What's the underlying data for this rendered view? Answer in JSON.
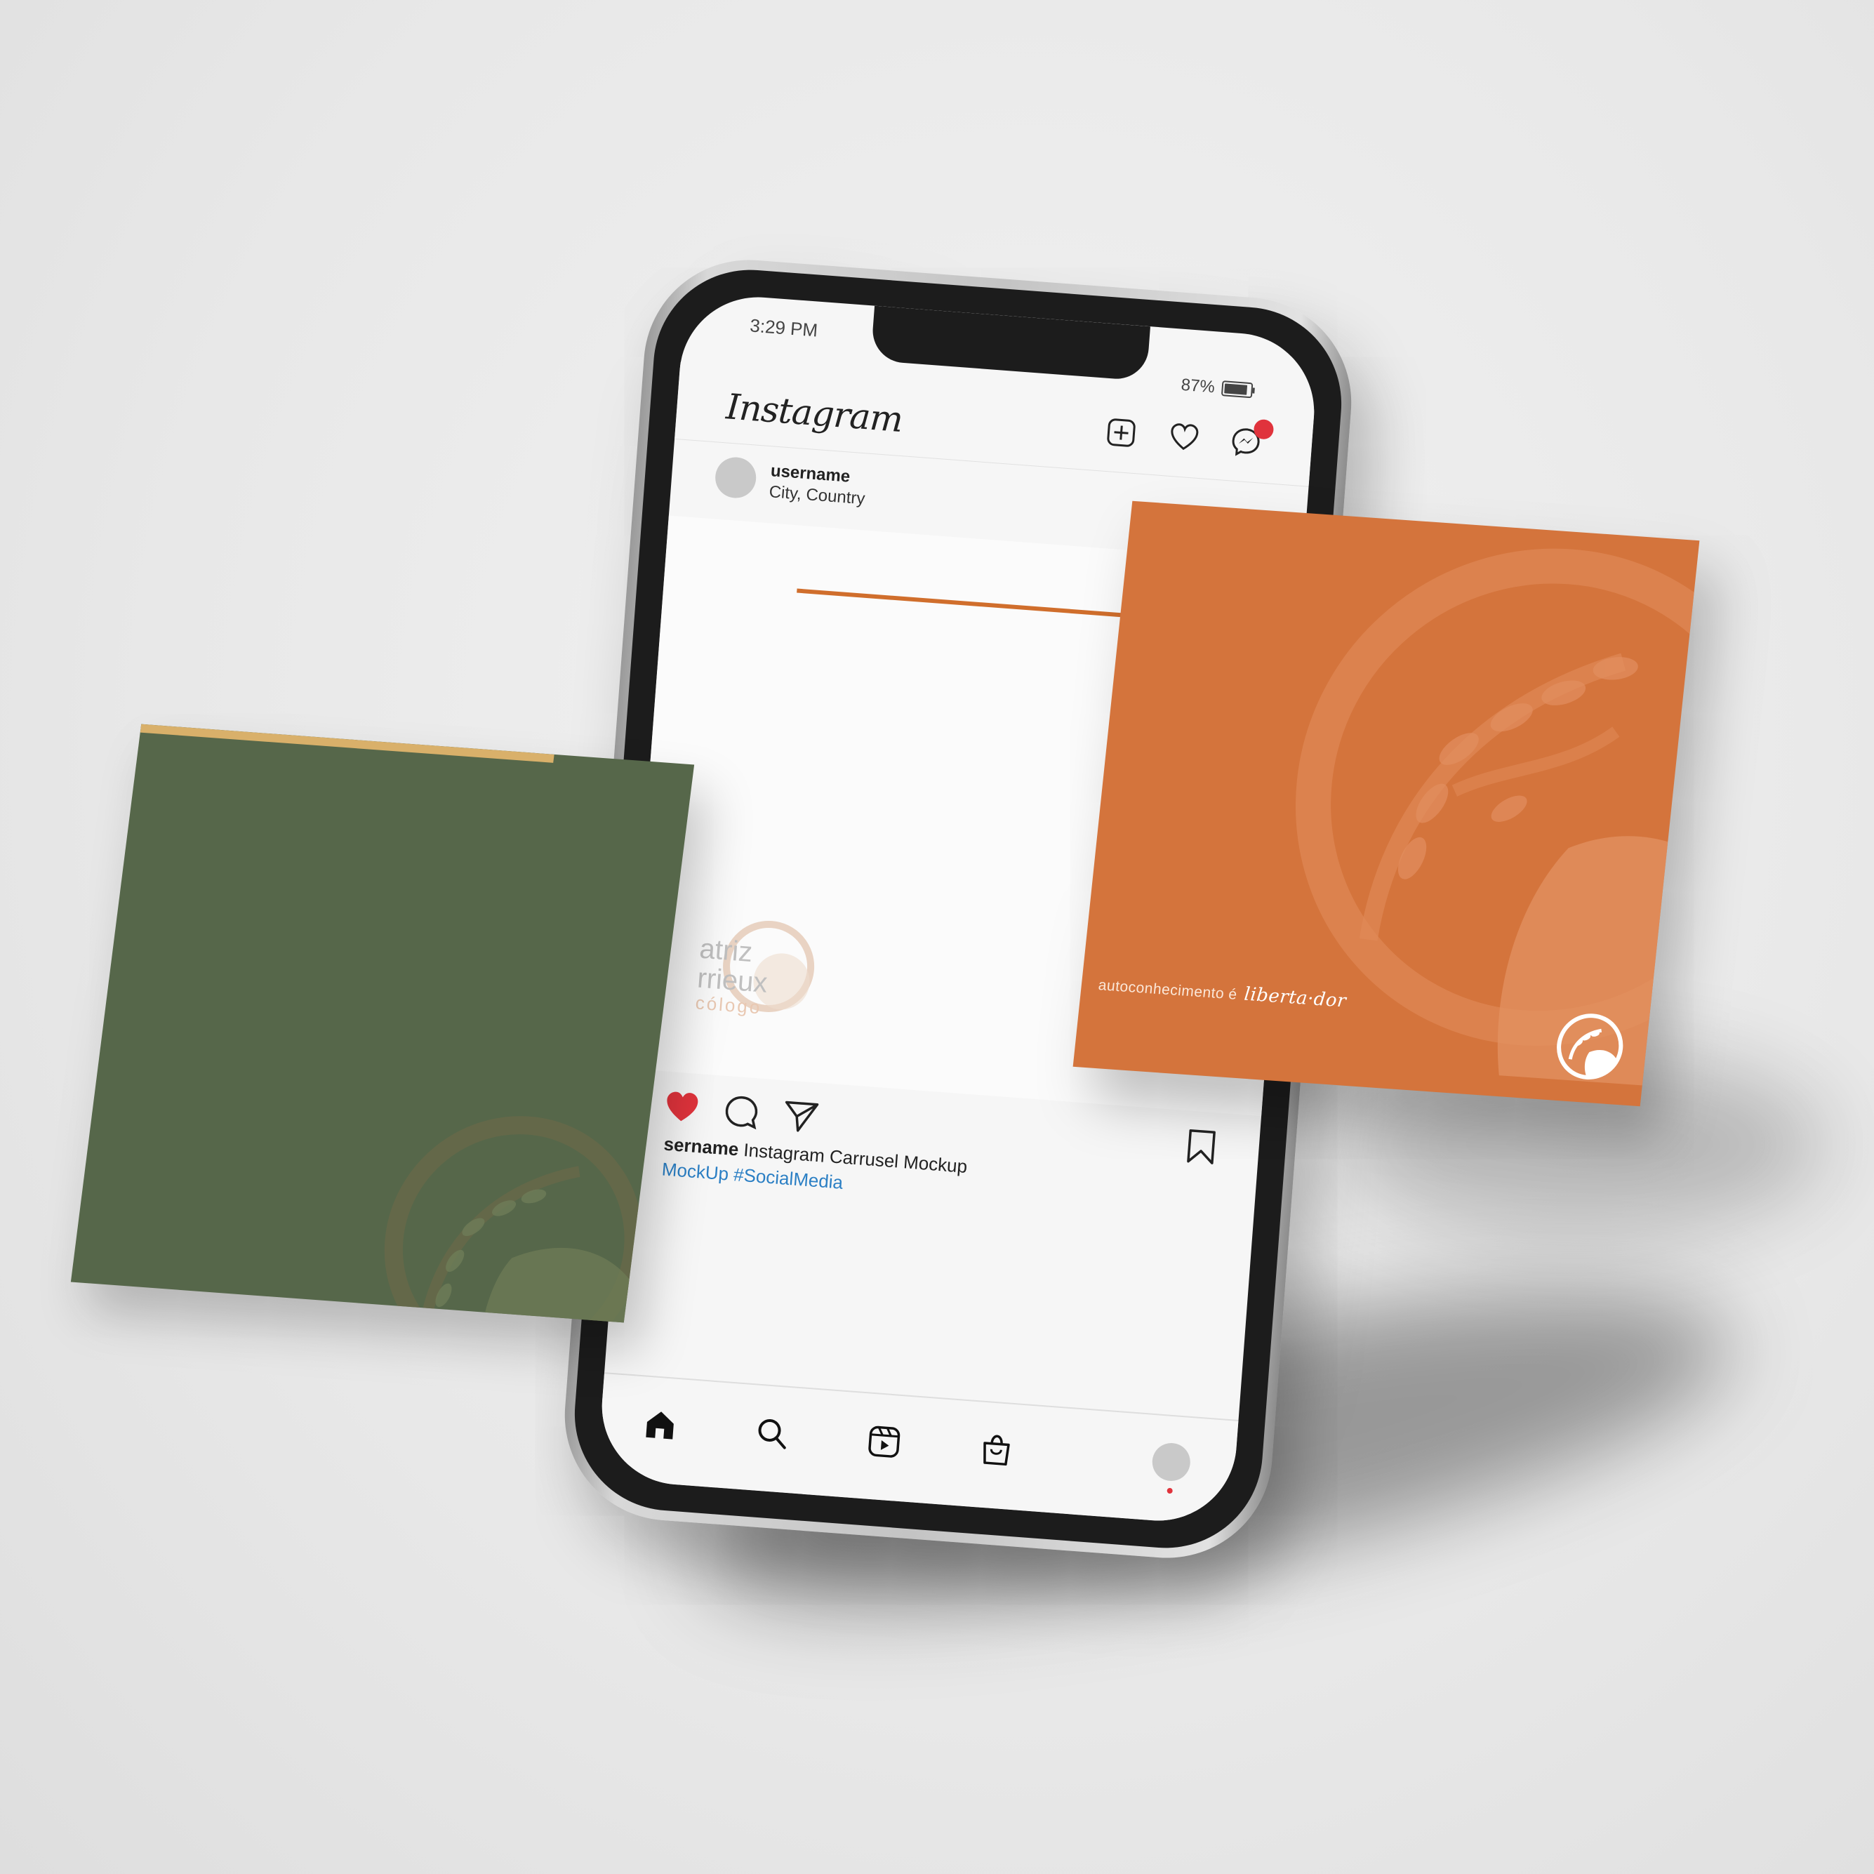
{
  "status_bar": {
    "time": "3:29 PM",
    "battery": "87%"
  },
  "header": {
    "app_name": "Instagram",
    "icons": [
      "new-post-icon",
      "heart-icon",
      "messenger-icon"
    ]
  },
  "post": {
    "username": "username",
    "location": "City, Country",
    "watermark": {
      "line1": "atriz",
      "line2": "rrieux",
      "line3": "cólogo"
    },
    "actions": [
      "like-icon",
      "comment-icon",
      "share-icon",
      "bookmark-icon"
    ],
    "caption_user": "sername",
    "caption_text": " Instagram Carrusel Mockup",
    "caption_tags": "MockUp #SocialMedia"
  },
  "tabbar": {
    "icons": [
      "home-icon",
      "search-icon",
      "reels-icon",
      "shop-icon",
      "profile-avatar"
    ]
  },
  "orange_card": {
    "tagline_plain": "autoconhecimento é",
    "tagline_script": "liberta·dor"
  },
  "colors": {
    "orange": "#d4743c",
    "green": "#56674a",
    "gold_strip": "#d9b06a",
    "notification": "#e0333c",
    "hashtag": "#2b7fc4"
  }
}
